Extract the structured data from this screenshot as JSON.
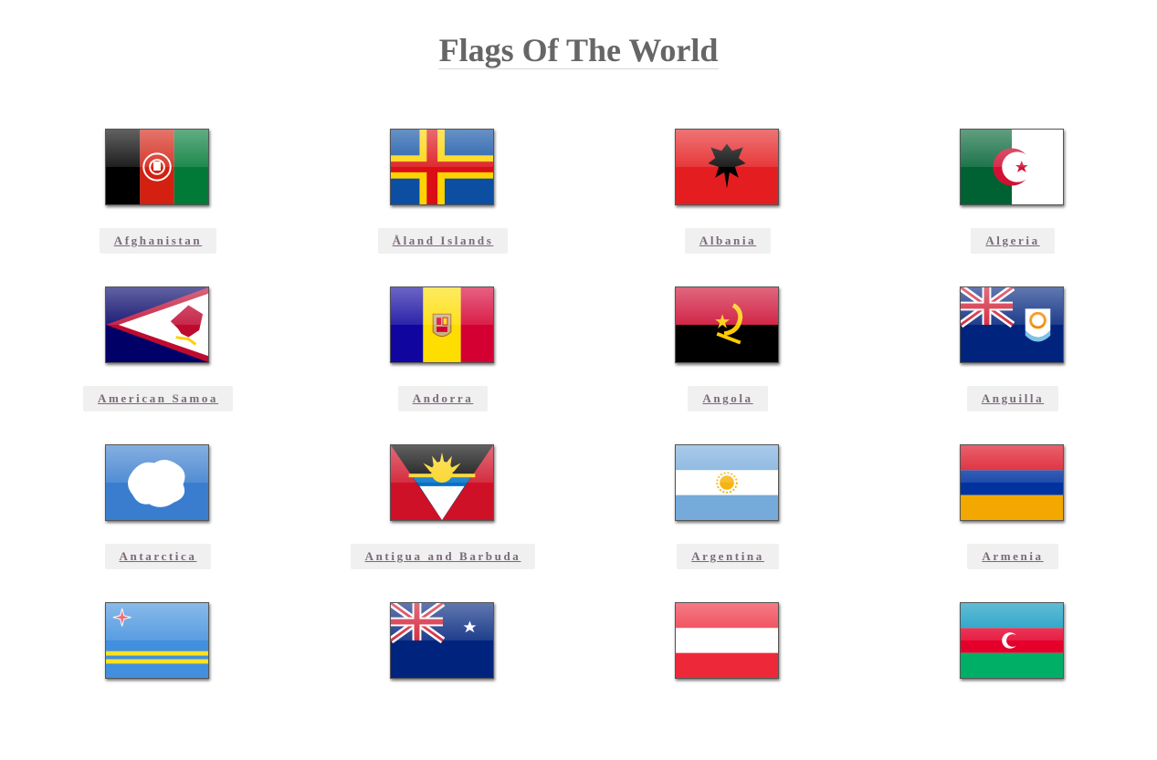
{
  "page": {
    "title": "Flags Of The World"
  },
  "countries": [
    {
      "name": "Afghanistan",
      "flag_icon": "afghanistan-flag"
    },
    {
      "name": "Åland Islands",
      "flag_icon": "aland-islands-flag"
    },
    {
      "name": "Albania",
      "flag_icon": "albania-flag"
    },
    {
      "name": "Algeria",
      "flag_icon": "algeria-flag"
    },
    {
      "name": "American Samoa",
      "flag_icon": "american-samoa-flag"
    },
    {
      "name": "Andorra",
      "flag_icon": "andorra-flag"
    },
    {
      "name": "Angola",
      "flag_icon": "angola-flag"
    },
    {
      "name": "Anguilla",
      "flag_icon": "anguilla-flag"
    },
    {
      "name": "Antarctica",
      "flag_icon": "antarctica-flag"
    },
    {
      "name": "Antigua and Barbuda",
      "flag_icon": "antigua-and-barbuda-flag"
    },
    {
      "name": "Argentina",
      "flag_icon": "argentina-flag"
    },
    {
      "name": "Armenia",
      "flag_icon": "armenia-flag"
    },
    {
      "name": "",
      "flag_icon": "aruba-flag"
    },
    {
      "name": "",
      "flag_icon": "australia-flag"
    },
    {
      "name": "",
      "flag_icon": "austria-flag"
    },
    {
      "name": "",
      "flag_icon": "azerbaijan-flag"
    }
  ]
}
